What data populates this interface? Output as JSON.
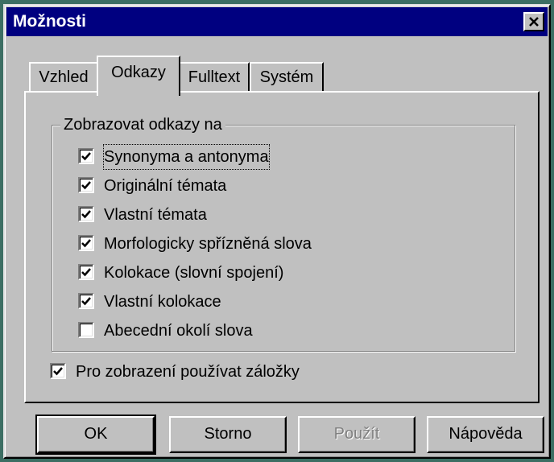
{
  "window": {
    "title": "Možnosti",
    "close_icon": "close-icon"
  },
  "tabs": [
    {
      "label": "Vzhled",
      "active": false
    },
    {
      "label": "Odkazy",
      "active": true
    },
    {
      "label": "Fulltext",
      "active": false
    },
    {
      "label": "Systém",
      "active": false
    }
  ],
  "group": {
    "title": "Zobrazovat odkazy na",
    "items": [
      {
        "label": "Synonyma a antonyma",
        "checked": true
      },
      {
        "label": "Originální témata",
        "checked": true
      },
      {
        "label": "Vlastní témata",
        "checked": true
      },
      {
        "label": "Morfologicky spřízněná slova",
        "checked": true
      },
      {
        "label": "Kolokace (slovní spojení)",
        "checked": true
      },
      {
        "label": "Vlastní kolokace",
        "checked": true
      },
      {
        "label": "Abecední okolí slova",
        "checked": false
      }
    ]
  },
  "bookmark_option": {
    "label": "Pro zobrazení používat záložky",
    "checked": true
  },
  "buttons": {
    "ok": "OK",
    "cancel": "Storno",
    "apply": "Použít",
    "help": "Nápověda"
  },
  "colors": {
    "titlebar": "#000080",
    "face": "#c0c0c0",
    "desktop": "#3c6e63"
  }
}
